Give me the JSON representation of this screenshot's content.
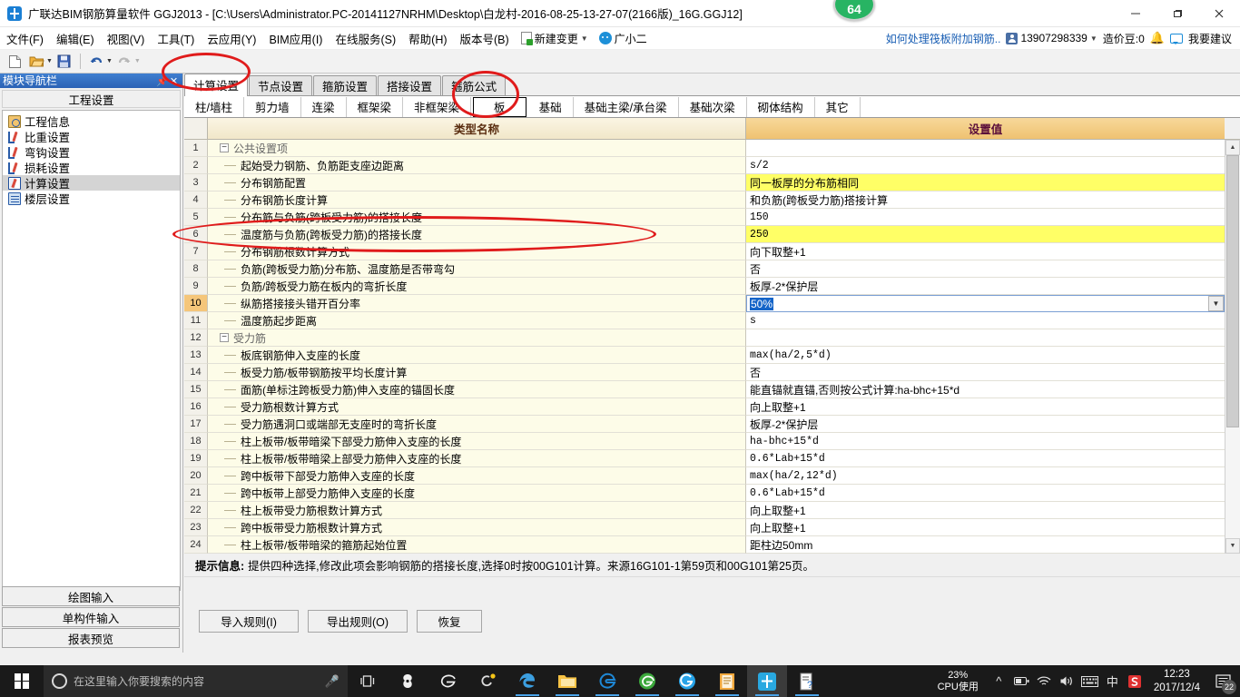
{
  "window": {
    "title": "广联达BIM钢筋算量软件 GGJ2013 - [C:\\Users\\Administrator.PC-20141127NRHM\\Desktop\\白龙村-2016-08-25-13-27-07(2166版)_16G.GGJ12]",
    "badge": "64",
    "minimize": "—",
    "maximize": "❐",
    "close": "✕"
  },
  "menu": {
    "items": [
      "文件(F)",
      "编辑(E)",
      "视图(V)",
      "工具(T)",
      "云应用(Y)",
      "BIM应用(I)",
      "在线服务(S)",
      "帮助(H)",
      "版本号(B)"
    ],
    "new_change": "新建变更",
    "assistant": "广小二",
    "right_link": "如何处理筏板附加钢筋..",
    "phone": "13907298339",
    "coin": "造价豆:0",
    "suggest": "我要建议"
  },
  "leftpanel": {
    "nav_title": "模块导航栏",
    "pin": "⊞",
    "close": "✕",
    "group_title": "工程设置",
    "items": [
      {
        "label": "工程信息",
        "icon": "info-icon"
      },
      {
        "label": "比重设置",
        "icon": "pen-icon"
      },
      {
        "label": "弯钩设置",
        "icon": "pen-icon"
      },
      {
        "label": "损耗设置",
        "icon": "pen-icon"
      },
      {
        "label": "计算设置",
        "icon": "calc-icon"
      },
      {
        "label": "楼层设置",
        "icon": "floor-icon"
      }
    ],
    "selected_index": 4,
    "buttons": [
      "绘图输入",
      "单构件输入",
      "报表预览"
    ]
  },
  "tabs_primary": {
    "items": [
      "计算设置",
      "节点设置",
      "箍筋设置",
      "搭接设置",
      "箍筋公式"
    ],
    "active": "计算设置"
  },
  "tabs_secondary": {
    "items": [
      "柱/墙柱",
      "剪力墙",
      "连梁",
      "框架梁",
      "非框架梁",
      "板",
      "基础",
      "基础主梁/承台梁",
      "基础次梁",
      "砌体结构",
      "其它"
    ],
    "active": "板"
  },
  "grid": {
    "headers": {
      "num": "",
      "name": "类型名称",
      "value": "设置值"
    },
    "rows": [
      {
        "num": "1",
        "type": "group",
        "name": "公共设置项",
        "value": ""
      },
      {
        "num": "2",
        "type": "item",
        "name": "起始受力钢筋、负筋距支座边距离",
        "value": "s/2",
        "mono": true
      },
      {
        "num": "3",
        "type": "item",
        "name": "分布钢筋配置",
        "value": "同一板厚的分布筋相同",
        "highlight": true
      },
      {
        "num": "4",
        "type": "item",
        "name": "分布钢筋长度计算",
        "value": "和负筋(跨板受力筋)搭接计算"
      },
      {
        "num": "5",
        "type": "item",
        "name": "分布筋与负筋(跨板受力筋)的搭接长度",
        "value": "150",
        "mono": true
      },
      {
        "num": "6",
        "type": "item",
        "name": "温度筋与负筋(跨板受力筋)的搭接长度",
        "value": "250",
        "mono": true,
        "highlight": true
      },
      {
        "num": "7",
        "type": "item",
        "name": "分布钢筋根数计算方式",
        "value": "向下取整+1"
      },
      {
        "num": "8",
        "type": "item",
        "name": "负筋(跨板受力筋)分布筋、温度筋是否带弯勾",
        "value": "否"
      },
      {
        "num": "9",
        "type": "item",
        "name": "负筋/跨板受力筋在板内的弯折长度",
        "value": "板厚-2*保护层"
      },
      {
        "num": "10",
        "type": "edit",
        "name": "纵筋搭接接头错开百分率",
        "value": "50%",
        "current": true
      },
      {
        "num": "11",
        "type": "item",
        "name": "温度筋起步距离",
        "value": "s",
        "mono": true
      },
      {
        "num": "12",
        "type": "group",
        "name": "受力筋",
        "value": ""
      },
      {
        "num": "13",
        "type": "item",
        "name": "板底钢筋伸入支座的长度",
        "value": "max(ha/2,5*d)",
        "mono": true
      },
      {
        "num": "14",
        "type": "item",
        "name": "板受力筋/板带钢筋按平均长度计算",
        "value": "否"
      },
      {
        "num": "15",
        "type": "item",
        "name": "面筋(单标注跨板受力筋)伸入支座的锚固长度",
        "value": "能直锚就直锚,否则按公式计算:ha-bhc+15*d"
      },
      {
        "num": "16",
        "type": "item",
        "name": "受力筋根数计算方式",
        "value": "向上取整+1"
      },
      {
        "num": "17",
        "type": "item",
        "name": "受力筋遇洞口或端部无支座时的弯折长度",
        "value": "板厚-2*保护层"
      },
      {
        "num": "18",
        "type": "item",
        "name": "柱上板带/板带暗梁下部受力筋伸入支座的长度",
        "value": "ha-bhc+15*d",
        "mono": true
      },
      {
        "num": "19",
        "type": "item",
        "name": "柱上板带/板带暗梁上部受力筋伸入支座的长度",
        "value": "0.6*Lab+15*d",
        "mono": true
      },
      {
        "num": "20",
        "type": "item",
        "name": "跨中板带下部受力筋伸入支座的长度",
        "value": "max(ha/2,12*d)",
        "mono": true
      },
      {
        "num": "21",
        "type": "item",
        "name": "跨中板带上部受力筋伸入支座的长度",
        "value": "0.6*Lab+15*d",
        "mono": true
      },
      {
        "num": "22",
        "type": "item",
        "name": "柱上板带受力筋根数计算方式",
        "value": "向上取整+1"
      },
      {
        "num": "23",
        "type": "item",
        "name": "跨中板带受力筋根数计算方式",
        "value": "向上取整+1"
      },
      {
        "num": "24",
        "type": "item",
        "name": "柱上板带/板带暗梁的箍筋起始位置",
        "value": "距柱边50mm"
      }
    ]
  },
  "hint": {
    "label": "提示信息:",
    "text": "提供四种选择,修改此项会影响钢筋的搭接长度,选择0时按00G101计算。来源16G101-1第59页和00G101第25页。"
  },
  "buttons": {
    "import": "导入规则(I)",
    "export": "导出规则(O)",
    "restore": "恢复"
  },
  "taskbar": {
    "search_placeholder": "在这里输入你要搜索的内容",
    "cpu_percent": "23%",
    "cpu_label": "CPU使用",
    "ime": "中",
    "time": "12:23",
    "date": "2017/12/4",
    "notification_count": "22"
  }
}
